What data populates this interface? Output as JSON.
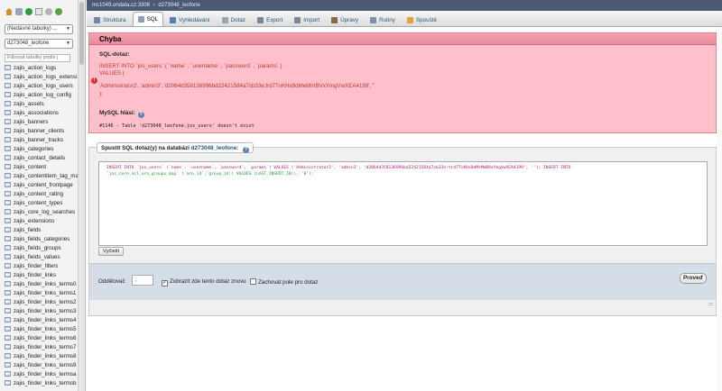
{
  "breadcrumb": {
    "server": "mc1049.ondata.cz:3306",
    "database": "d273048_leofone"
  },
  "tabs": [
    {
      "label": "Struktura",
      "icon": "structure-icon",
      "color": "#6f87a8"
    },
    {
      "label": "SQL",
      "icon": "sql-icon",
      "color": "#8a9fb9",
      "active": true
    },
    {
      "label": "Vyhledávání",
      "icon": "search-icon",
      "color": "#557fae"
    },
    {
      "label": "Dotaz",
      "icon": "query-icon",
      "color": "#9aa3b0"
    },
    {
      "label": "Export",
      "icon": "export-icon",
      "color": "#7a8797"
    },
    {
      "label": "Import",
      "icon": "import-icon",
      "color": "#7a8797"
    },
    {
      "label": "Úpravy",
      "icon": "wrench-icon",
      "color": "#8b6a3a"
    },
    {
      "label": "Rutiny",
      "icon": "routines-icon",
      "color": "#7b8fa7"
    },
    {
      "label": "Spouště",
      "icon": "triggers-icon",
      "color": "#e2a23c"
    }
  ],
  "sidebar": {
    "recent_tables": "(Nedávné tabulky) ...",
    "database_select": "d273048_leofone",
    "filter_placeholder": "Filtrovat tabulky podle j",
    "tables": [
      "zajis_action_logs",
      "zajis_action_logs_extensi",
      "zajis_action_logs_users",
      "zajis_action_log_config",
      "zajis_assets",
      "zajis_associations",
      "zajis_banners",
      "zajis_banner_clients",
      "zajis_banner_tracks",
      "zajis_categories",
      "zajis_contact_details",
      "zajis_content",
      "zajis_contentitem_tag_ma",
      "zajis_content_frontpage",
      "zajis_content_rating",
      "zajis_content_types",
      "zajis_core_log_searches",
      "zajis_extensions",
      "zajis_fields",
      "zajis_fields_categories",
      "zajis_fields_groups",
      "zajis_fields_values",
      "zajis_finder_filters",
      "zajis_finder_links",
      "zajis_finder_links_terms0",
      "zajis_finder_links_terms1",
      "zajis_finder_links_terms2",
      "zajis_finder_links_terms3",
      "zajis_finder_links_terms4",
      "zajis_finder_links_terms5",
      "zajis_finder_links_terms6",
      "zajis_finder_links_terms7",
      "zajis_finder_links_terms8",
      "zajis_finder_links_terms9",
      "zajis_finder_links_termsa",
      "zajis_finder_links_termsb"
    ]
  },
  "error": {
    "title": "Chyba",
    "sql_label": "SQL-dotaz:",
    "sql_line1": "INSERT INTO `jos_users` ( `name` , `username` , `password` , `params` )",
    "sql_line2": "VALUES (",
    "sql_line3": "'Administrator2', 'admin3', 'd2064d358136996bd22421584a7cb33e:trd7TvKHx8dMeMmBVxYmgVwXEA4199', ''",
    "sql_line4": ");",
    "mysql_label": "MySQL hlásí:",
    "message": "#1146 - Table 'd273048_leofone.jos_users' doesn't exist"
  },
  "query": {
    "legend_prefix": "Spustit SQL dotaz(y) na databázi",
    "legend_db": "d273048_leofone:",
    "sql_text_1": "INSERT INTO `jos_users` (`name`, `username`, `password`, `params`) VALUES ('Administrator2', 'admin3', 'd2064d358136996bd22421584a7cb33e:trd7TvKHx8dMeMmBVxYmgVwXEA4199', ''); INSERT INTO",
    "sql_text_2": "`jos_core_acl_aro_groups_map` (`aro_id`,`group_id`) VALUES (LAST_INSERT_ID(), '8');",
    "clear_label": "Vyčistit",
    "delimiter_label": "Oddělovač",
    "delimiter_value": ";",
    "show_query_label": "Zobrazit zde tento dotaz znovu",
    "show_query_checked": true,
    "retain_box_label": "Zachovat pole pro dotaz",
    "retain_box_checked": false,
    "go_label": "Proveď"
  }
}
